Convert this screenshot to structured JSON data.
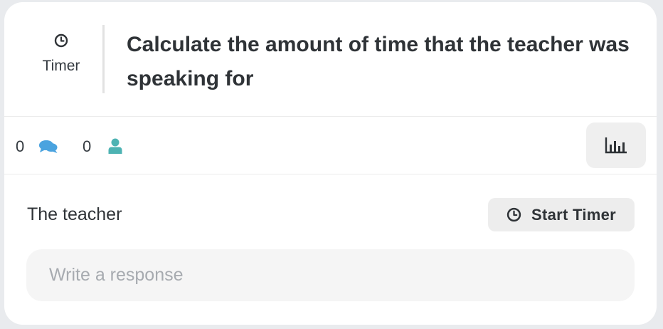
{
  "header": {
    "type_label": "Timer",
    "type_icon": "clock-icon",
    "title": "Calculate the amount of time that the teacher was speaking for"
  },
  "stats": {
    "comments_count": "0",
    "comments_icon": "comments-icon",
    "participants_count": "0",
    "participants_icon": "user-icon",
    "chart_button_icon": "bar-chart-icon"
  },
  "response": {
    "subject": "The teacher",
    "start_timer_label": "Start Timer",
    "start_timer_icon": "clock-icon",
    "input_value": "",
    "input_placeholder": "Write a response"
  },
  "colors": {
    "comments_icon": "#4aa3df",
    "user_icon": "#4db3b3",
    "text": "#2f3337",
    "placeholder": "#a7abb0"
  }
}
